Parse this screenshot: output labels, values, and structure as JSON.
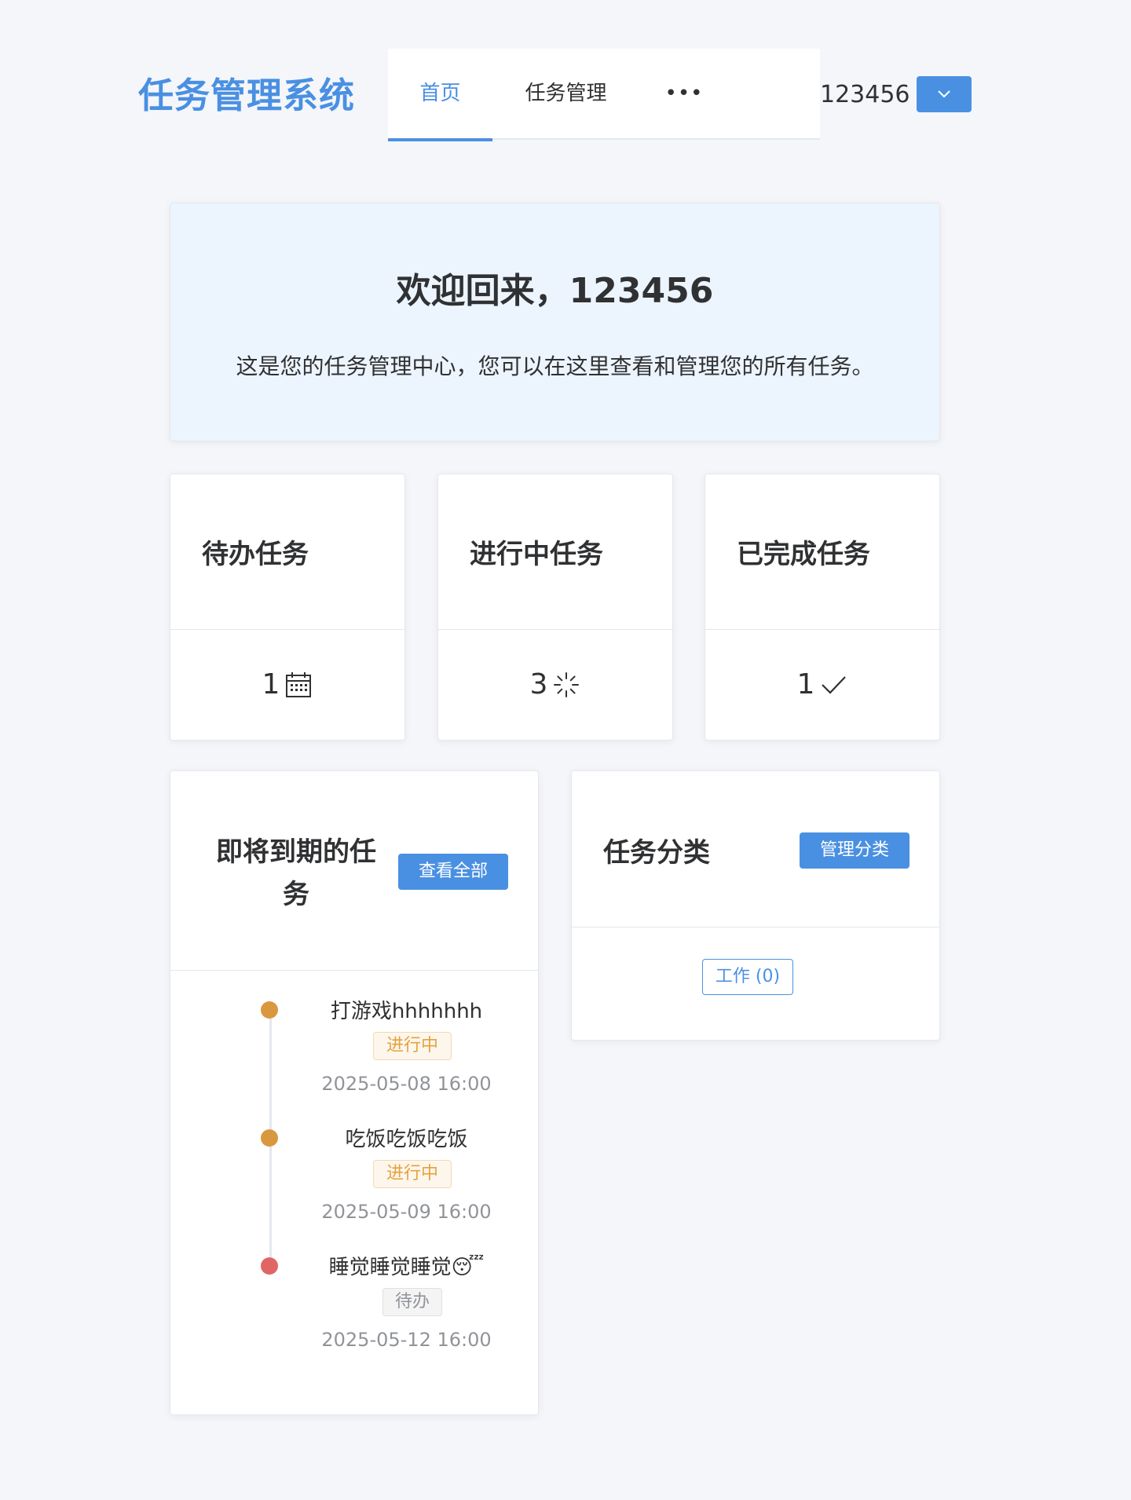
{
  "header": {
    "logo": "任务管理系统",
    "nav": [
      {
        "label": "首页",
        "active": true
      },
      {
        "label": "任务管理",
        "active": false
      }
    ],
    "more_label": "•••",
    "user_name": "123456"
  },
  "welcome": {
    "title": "欢迎回来，123456",
    "description": "这是您的任务管理中心，您可以在这里查看和管理您的所有任务。"
  },
  "stats": [
    {
      "title": "待办任务",
      "value": "1",
      "icon": "calendar-icon"
    },
    {
      "title": "进行中任务",
      "value": "3",
      "icon": "loading-icon"
    },
    {
      "title": "已完成任务",
      "value": "1",
      "icon": "check-icon"
    }
  ],
  "upcoming": {
    "title_line1": "即将到期的任",
    "title_line2": "务",
    "view_all_label": "查看全部",
    "items": [
      {
        "title": "打游戏hhhhhhh",
        "status": "进行中",
        "status_type": "progress",
        "time": "2025-05-08 16:00",
        "dot_color": "#d9983f"
      },
      {
        "title": "吃饭吃饭吃饭",
        "status": "进行中",
        "status_type": "progress",
        "time": "2025-05-09 16:00",
        "dot_color": "#d9983f"
      },
      {
        "title": "睡觉睡觉睡觉😴",
        "status": "待办",
        "status_type": "todo",
        "time": "2025-05-12 16:00",
        "dot_color": "#e06666"
      }
    ]
  },
  "categories": {
    "title": "任务分类",
    "manage_label": "管理分类",
    "tags": [
      {
        "label": "工作 (0)"
      }
    ]
  },
  "colors": {
    "primary": "#4a90e2",
    "background": "#f4f6fa",
    "welcome_bg": "#ecf5fe"
  }
}
